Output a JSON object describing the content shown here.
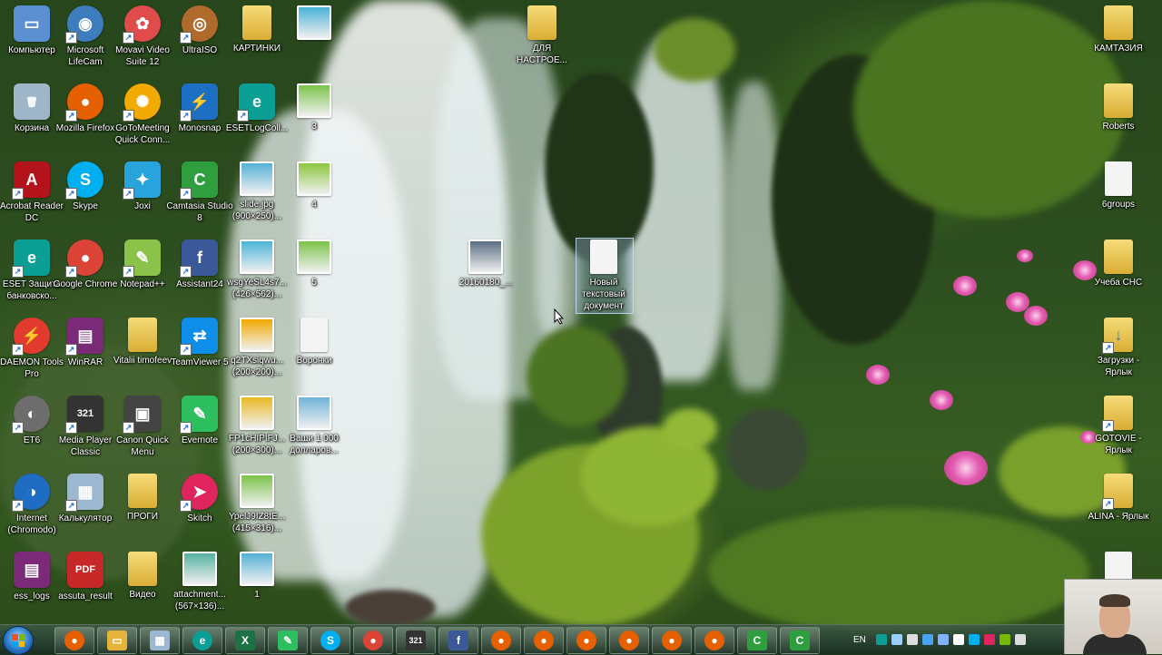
{
  "desktop": {
    "icons": [
      {
        "id": "komputer",
        "label": "Компьютер",
        "icon": "computer-icon",
        "color": "#5a8fd1",
        "glyph": "▭"
      },
      {
        "id": "lifecam",
        "label": "Microsoft LifeCam",
        "icon": "webcam-icon",
        "color": "#3d7dbd",
        "glyph": "◉"
      },
      {
        "id": "movavi",
        "label": "Movavi Video Suite 12",
        "icon": "movavi-icon",
        "color": "#e04b4b",
        "glyph": "✿"
      },
      {
        "id": "ultraiso",
        "label": "UltraISO",
        "icon": "disc-icon",
        "color": "#b06b2c",
        "glyph": "◎"
      },
      {
        "id": "kartinki",
        "label": "КАРТИНКИ",
        "icon": "folder-icon",
        "color": "#d9ad33",
        "glyph": ""
      },
      {
        "id": "golddays",
        "label": "",
        "icon": "image-thumbnail-icon",
        "color": "#4ab3d8",
        "glyph": ""
      },
      {
        "id": "korzina",
        "label": "Корзина",
        "icon": "recycle-bin-icon",
        "color": "#9fb6c9",
        "glyph": "🗑"
      },
      {
        "id": "firefox1",
        "label": "Mozilla Firefox",
        "icon": "firefox-icon",
        "color": "#e66000",
        "glyph": "●"
      },
      {
        "id": "gotomeeting",
        "label": "GoToMeeting Quick Conn...",
        "icon": "gotomeeting-icon",
        "color": "#f2a900",
        "glyph": "✺"
      },
      {
        "id": "monosnap",
        "label": "Monosnap",
        "icon": "monosnap-icon",
        "color": "#1c6fc2",
        "glyph": "⚡"
      },
      {
        "id": "esetlog",
        "label": "ESETLogColl...",
        "icon": "eset-icon",
        "color": "#0a9e94",
        "glyph": "e"
      },
      {
        "id": "thumb3",
        "label": "3",
        "icon": "image-thumbnail-icon",
        "color": "#7cc34a",
        "glyph": ""
      },
      {
        "id": "acrobat",
        "label": "Acrobat Reader DC",
        "icon": "acrobat-icon",
        "color": "#b3141b",
        "glyph": "A"
      },
      {
        "id": "skype",
        "label": "Skype",
        "icon": "skype-icon",
        "color": "#00aff0",
        "glyph": "S"
      },
      {
        "id": "joxi",
        "label": "Joxi",
        "icon": "joxi-bird-icon",
        "color": "#29a3dc",
        "glyph": "✦"
      },
      {
        "id": "camtasia",
        "label": "Camtasia Studio 8",
        "icon": "camtasia-icon",
        "color": "#2e9e3f",
        "glyph": "C"
      },
      {
        "id": "slide",
        "label": "slide.jpg (900×250)...",
        "icon": "image-thumbnail-icon",
        "color": "#55b1d6",
        "glyph": ""
      },
      {
        "id": "thumb4",
        "label": "4",
        "icon": "image-thumbnail-icon",
        "color": "#8dc63f",
        "glyph": ""
      },
      {
        "id": "esetbank",
        "label": "ESET Защита банковско...",
        "icon": "eset-icon",
        "color": "#0a9e94",
        "glyph": "e"
      },
      {
        "id": "chrome",
        "label": "Google Chrome",
        "icon": "chrome-icon",
        "color": "#db4437",
        "glyph": "●"
      },
      {
        "id": "notepadpp",
        "label": "Notepad++",
        "icon": "notepad-plus-icon",
        "color": "#8bc34a",
        "glyph": "✎"
      },
      {
        "id": "assistant24",
        "label": "Assistant24",
        "icon": "facebook-icon",
        "color": "#3b5998",
        "glyph": "f"
      },
      {
        "id": "wsg",
        "label": "wsgYeSL4s7... (426×562)...",
        "icon": "image-thumbnail-icon",
        "color": "#4ab3d8",
        "glyph": ""
      },
      {
        "id": "thumb5",
        "label": "5",
        "icon": "image-thumbnail-icon",
        "color": "#7cc34a",
        "glyph": ""
      },
      {
        "id": "daemon",
        "label": "DAEMON Tools Pro",
        "icon": "daemon-tools-icon",
        "color": "#e23a2e",
        "glyph": "⚡"
      },
      {
        "id": "winrar",
        "label": "WinRAR",
        "icon": "winrar-icon",
        "color": "#7b2a78",
        "glyph": "▤"
      },
      {
        "id": "vitalii",
        "label": "Vitalii timofeev",
        "icon": "folder-icon",
        "color": "#d9ad33",
        "glyph": ""
      },
      {
        "id": "teamviewer",
        "label": "TeamViewer 5",
        "icon": "teamviewer-icon",
        "color": "#0e8ee9",
        "glyph": "⇄"
      },
      {
        "id": "q2t",
        "label": "q2TXsiqwu... (200×200)...",
        "icon": "image-thumbnail-icon",
        "color": "#f2a900",
        "glyph": ""
      },
      {
        "id": "voronki",
        "label": "Воронки",
        "icon": "text-document-icon",
        "color": "#f4f4f4",
        "glyph": ""
      },
      {
        "id": "et6",
        "label": "ET6",
        "icon": "et6-icon",
        "color": "#6d6d6d",
        "glyph": "◐"
      },
      {
        "id": "mpc",
        "label": "Media Player Classic",
        "icon": "media-player-icon",
        "color": "#333333",
        "glyph": "321"
      },
      {
        "id": "canon",
        "label": "Canon Quick Menu",
        "icon": "canon-icon",
        "color": "#444444",
        "glyph": "▣"
      },
      {
        "id": "evernote",
        "label": "Evernote",
        "icon": "evernote-icon",
        "color": "#2dbe60",
        "glyph": "✎"
      },
      {
        "id": "fp",
        "label": "FP1cHIPIFJ... (200×300)...",
        "icon": "image-thumbnail-icon",
        "color": "#e8b923",
        "glyph": ""
      },
      {
        "id": "vashi",
        "label": "Ваши 1 000 долларов...",
        "icon": "image-thumbnail-icon",
        "color": "#6fb3d8",
        "glyph": ""
      },
      {
        "id": "internet",
        "label": "Internet (Chromodo)",
        "icon": "chromodo-icon",
        "color": "#1e6dc2",
        "glyph": "◑"
      },
      {
        "id": "calc",
        "label": "Калькулятор",
        "icon": "calculator-icon",
        "color": "#9cb7d0",
        "glyph": "▦"
      },
      {
        "id": "progi",
        "label": "ПРОГИ",
        "icon": "folder-icon",
        "color": "#d9ad33",
        "glyph": ""
      },
      {
        "id": "skitch",
        "label": "Skitch",
        "icon": "skitch-icon",
        "color": "#e0245e",
        "glyph": "➤"
      },
      {
        "id": "ypel",
        "label": "YpelJ9IZ8tE... (415×316)...",
        "icon": "image-thumbnail-icon",
        "color": "#7cc34a",
        "glyph": ""
      },
      {
        "id": "esslogs",
        "label": "ess_logs",
        "icon": "winrar-icon",
        "color": "#7b2a78",
        "glyph": "▤"
      },
      {
        "id": "assuta",
        "label": "assuta_result",
        "icon": "pdf-icon",
        "color": "#c62828",
        "glyph": "PDF"
      },
      {
        "id": "video",
        "label": "Видео",
        "icon": "folder-icon",
        "color": "#d9ad33",
        "glyph": ""
      },
      {
        "id": "attachment",
        "label": "attachment... (567×136)...",
        "icon": "image-thumbnail-icon",
        "color": "#55b1a0",
        "glyph": ""
      },
      {
        "id": "thumb1",
        "label": "1",
        "icon": "image-thumbnail-icon",
        "color": "#55b1d6",
        "glyph": ""
      },
      {
        "id": "dlya",
        "label": "ДЛЯ НАСТРОЕ...",
        "icon": "folder-icon",
        "color": "#d9ad33",
        "glyph": ""
      },
      {
        "id": "photo2016",
        "label": "20160180_...",
        "icon": "image-thumbnail-icon",
        "color": "#5a6f83",
        "glyph": ""
      },
      {
        "id": "newtxt",
        "label": "Новый текстовый документ",
        "icon": "text-document-icon",
        "color": "#f4f4f4",
        "glyph": ""
      },
      {
        "id": "kamtazia",
        "label": "КАМТАЗИЯ",
        "icon": "folder-icon",
        "color": "#d9ad33",
        "glyph": ""
      },
      {
        "id": "roberts",
        "label": "Roberts",
        "icon": "folder-icon",
        "color": "#d9ad33",
        "glyph": ""
      },
      {
        "id": "6groups",
        "label": "6groups",
        "icon": "text-document-icon",
        "color": "#f4f4f4",
        "glyph": ""
      },
      {
        "id": "ucheba",
        "label": "Учеба СНС",
        "icon": "folder-icon",
        "color": "#d9ad33",
        "glyph": ""
      },
      {
        "id": "zagruzki",
        "label": "Загрузки - Ярлык",
        "icon": "downloads-folder-icon",
        "color": "#d9ad33",
        "glyph": ""
      },
      {
        "id": "gotovie",
        "label": "GOTOVIE - Ярлык",
        "icon": "folder-icon",
        "color": "#d9ad33",
        "glyph": ""
      },
      {
        "id": "alina",
        "label": "ALINA - Ярлык",
        "icon": "folder-icon",
        "color": "#d9ad33",
        "glyph": ""
      },
      {
        "id": "blankdoc",
        "label": "",
        "icon": "text-document-icon",
        "color": "#f4f4f4",
        "glyph": ""
      }
    ]
  },
  "taskbar": {
    "start_icon": "windows-start-icon",
    "buttons": [
      {
        "icon": "firefox-icon",
        "color": "#e66000",
        "glyph": "●"
      },
      {
        "icon": "explorer-folder-icon",
        "color": "#e6b33a",
        "glyph": "▭"
      },
      {
        "icon": "calculator-icon",
        "color": "#9cb7d0",
        "glyph": "▦"
      },
      {
        "icon": "eset-icon",
        "color": "#0a9e94",
        "glyph": "e"
      },
      {
        "icon": "excel-icon",
        "color": "#1e7145",
        "glyph": "X"
      },
      {
        "icon": "evernote-icon",
        "color": "#2dbe60",
        "glyph": "✎"
      },
      {
        "icon": "skype-icon",
        "color": "#00aff0",
        "glyph": "S"
      },
      {
        "icon": "chrome-icon",
        "color": "#db4437",
        "glyph": "●"
      },
      {
        "icon": "media-player-icon",
        "color": "#333333",
        "glyph": "321"
      },
      {
        "icon": "facebook-icon",
        "color": "#3b5998",
        "glyph": "f"
      },
      {
        "icon": "firefox-icon",
        "color": "#e66000",
        "glyph": "●"
      },
      {
        "icon": "firefox-icon",
        "color": "#e66000",
        "glyph": "●"
      },
      {
        "icon": "firefox-icon",
        "color": "#e66000",
        "glyph": "●"
      },
      {
        "icon": "firefox-icon",
        "color": "#e66000",
        "glyph": "●"
      },
      {
        "icon": "firefox-icon",
        "color": "#e66000",
        "glyph": "●"
      },
      {
        "icon": "firefox-icon",
        "color": "#e66000",
        "glyph": "●"
      },
      {
        "icon": "camtasia-icon",
        "color": "#2e9e3f",
        "glyph": "C"
      },
      {
        "icon": "camtasia-recorder-icon",
        "color": "#2e9e3f",
        "glyph": "C"
      }
    ],
    "tray": {
      "language": "EN",
      "icons": [
        {
          "icon": "eset-tray-icon",
          "color": "#0a9e94"
        },
        {
          "icon": "network-tray-icon",
          "color": "#9ad0ff"
        },
        {
          "icon": "flag-tray-icon",
          "color": "#dddddd"
        },
        {
          "icon": "monosnap-tray-icon",
          "color": "#4aa3f0"
        },
        {
          "icon": "dropbox-tray-icon",
          "color": "#7fb2ff"
        },
        {
          "icon": "windows-tray-icon",
          "color": "#ffffff"
        },
        {
          "icon": "skype-tray-icon",
          "color": "#00aff0"
        },
        {
          "icon": "record-tray-icon",
          "color": "#e0245e"
        },
        {
          "icon": "nvidia-tray-icon",
          "color": "#76b900"
        },
        {
          "icon": "volume-tray-icon",
          "color": "#dddddd"
        }
      ]
    }
  }
}
